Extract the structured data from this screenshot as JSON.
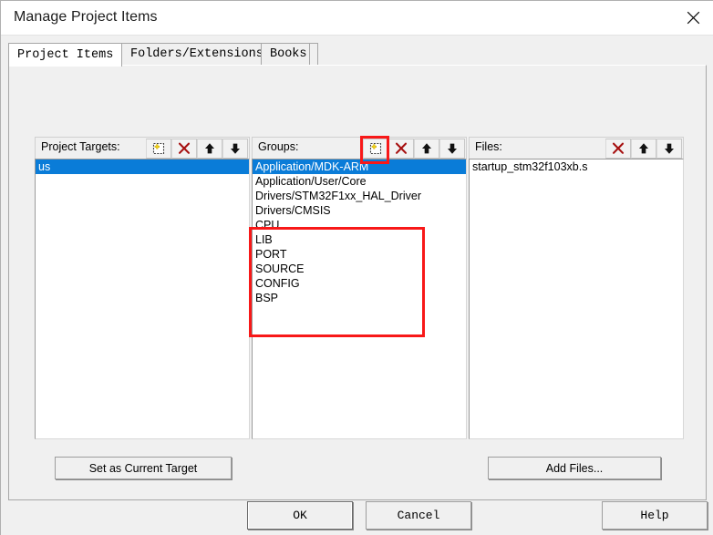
{
  "window": {
    "title": "Manage Project Items",
    "close_icon": "close-icon"
  },
  "tabs": [
    {
      "label": "Project Items",
      "active": true
    },
    {
      "label": "Folders/Extensions",
      "active": false
    },
    {
      "label": "Books",
      "active": false
    }
  ],
  "panels": {
    "targets": {
      "header_label": "Project Targets:",
      "icons": [
        "new-item-icon",
        "delete-icon",
        "move-up-icon",
        "move-down-icon"
      ],
      "items": [
        {
          "label": "us",
          "selected": true
        }
      ]
    },
    "groups": {
      "header_label": "Groups:",
      "icons": [
        "new-item-icon",
        "delete-icon",
        "move-up-icon",
        "move-down-icon"
      ],
      "items": [
        {
          "label": "Application/MDK-ARM",
          "selected": true
        },
        {
          "label": "Application/User/Core",
          "selected": false
        },
        {
          "label": "Drivers/STM32F1xx_HAL_Driver",
          "selected": false
        },
        {
          "label": "Drivers/CMSIS",
          "selected": false
        },
        {
          "label": "CPU",
          "selected": false
        },
        {
          "label": "LIB",
          "selected": false
        },
        {
          "label": "PORT",
          "selected": false
        },
        {
          "label": "SOURCE",
          "selected": false
        },
        {
          "label": "CONFIG",
          "selected": false
        },
        {
          "label": "BSP",
          "selected": false
        }
      ]
    },
    "files": {
      "header_label": "Files:",
      "icons": [
        "delete-icon",
        "move-up-icon",
        "move-down-icon"
      ],
      "items": [
        {
          "label": "startup_stm32f103xb.s",
          "selected": false
        }
      ]
    }
  },
  "buttons": {
    "set_current_target": "Set as Current Target",
    "add_files": "Add Files...",
    "ok": "OK",
    "cancel": "Cancel",
    "help": "Help"
  },
  "annotations": {
    "accent_color": "#f81818",
    "highlight_new_group_button": true,
    "highlight_custom_groups": true
  },
  "colors": {
    "selection_blue": "#0a7cd8",
    "dialog_gray": "#f0f0f0",
    "delete_red": "#b01010"
  }
}
